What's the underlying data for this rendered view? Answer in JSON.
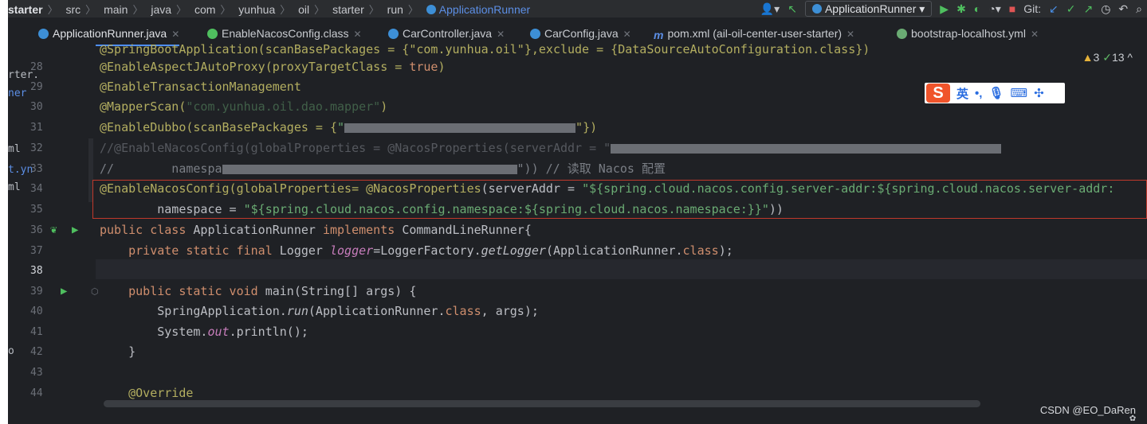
{
  "breadcrumb": {
    "items": [
      "starter",
      "src",
      "main",
      "java",
      "com",
      "yunhua",
      "oil",
      "starter",
      "run",
      "ApplicationRunner"
    ]
  },
  "toolbar": {
    "run_config": "ApplicationRunner",
    "git_label": "Git:"
  },
  "tabs": [
    {
      "label": "ApplicationRunner.java",
      "color": "#3d8fd6",
      "active": true
    },
    {
      "label": "EnableNacosConfig.class",
      "color": "#4fbf5f",
      "active": false
    },
    {
      "label": "CarController.java",
      "color": "#3d8fd6",
      "active": false
    },
    {
      "label": "CarConfig.java",
      "color": "#3d8fd6",
      "active": false
    },
    {
      "label": "pom.xml (ail-oil-center-user-starter)",
      "color": "#5c8fe6",
      "active": false
    },
    {
      "label": "bootstrap-localhost.yml",
      "color": "#6aab73",
      "active": false
    }
  ],
  "side_fragments": [
    "rter.",
    "ner",
    "ml",
    "t.yn",
    "ml",
    "o"
  ],
  "line_numbers": [
    "28",
    "29",
    "30",
    "31",
    "32",
    "33",
    "34",
    "35",
    "36",
    "37",
    "38",
    "39",
    "40",
    "41",
    "42",
    "43",
    "44"
  ],
  "current_line": "38",
  "warnings": {
    "warn_count": "3",
    "ok_count": "13"
  },
  "code": {
    "l27": "@SpringBootApplication(scanBasePackages = {\"com.yunhua.oil\"},exclude = {DataSourceAutoConfiguration.class})",
    "l28a": "@EnableAspectJAutoProxy(proxyTargetClass = ",
    "l28b": "true",
    "l28c": ")",
    "l29": "@EnableTransactionManagement",
    "l30a": "@MapperScan(",
    "l30b": "\"com.yunhua.oil.dao.mapper\"",
    "l30c": ")",
    "l31a": "@EnableDubbo(scanBasePackages = {",
    "l31b": "\"",
    "l31c": "\"})",
    "l32": "//@EnableNacosConfig(globalProperties = @NacosProperties(serverAddr = \"",
    "l33a": "//        namespa",
    "l33b": "\")) // 读取 Nacos 配置",
    "l34a": "@EnableNacosConfig(globalProperties= ",
    "l34b": "@NacosProperties",
    "l34c": "(serverAddr = ",
    "l34d": "\"${spring.cloud.nacos.config.server-addr:${spring.cloud.nacos.server-addr:",
    "l35a": "        namespace = ",
    "l35b": "\"${spring.cloud.nacos.config.namespace:${spring.cloud.nacos.namespace:}}\"",
    "l35c": "))",
    "l36a": "public class ",
    "l36b": "ApplicationRunner ",
    "l36c": "implements ",
    "l36d": "CommandLineRunner{",
    "l37a": "    private static final ",
    "l37b": "Logger ",
    "l37c": "logger",
    "l37d": "=LoggerFactory.",
    "l37e": "getLogger",
    "l37f": "(ApplicationRunner.",
    "l37g": "class",
    "l37h": ");",
    "l39a": "    public static void ",
    "l39b": "main(String[] args) {",
    "l40a": "        SpringApplication.",
    "l40b": "run",
    "l40c": "(ApplicationRunner.",
    "l40d": "class",
    "l40e": ", args);",
    "l41a": "        System.",
    "l41b": "out",
    "l41c": ".println();",
    "l42": "    }",
    "l44": "    @Override"
  },
  "ime": {
    "logo": "S",
    "lang": "英",
    "punct": "•,"
  },
  "watermark": "CSDN @EO_DaRen"
}
